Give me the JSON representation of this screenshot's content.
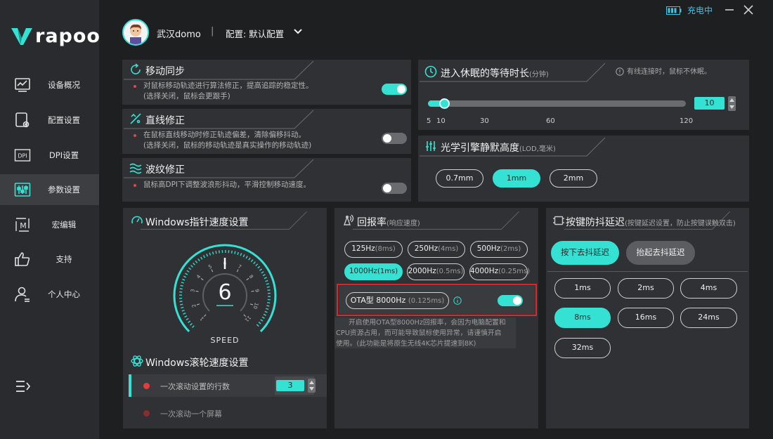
{
  "brand": {
    "name": "rapoo"
  },
  "header": {
    "user_name": "武汉domo",
    "separator": "|",
    "config_label": "配置: 默认配置",
    "charge_status": "充电中"
  },
  "sidebar": {
    "items": [
      {
        "label": "设备概况",
        "icon": "monitor-chart-icon"
      },
      {
        "label": "配置设置",
        "icon": "mouse-settings-icon"
      },
      {
        "label": "DPI设置",
        "icon": "dpi-icon",
        "icon_text": "DPI"
      },
      {
        "label": "参数设置",
        "icon": "sliders-icon",
        "active": true
      },
      {
        "label": "宏编辑",
        "icon": "macro-icon",
        "icon_text": "M"
      },
      {
        "label": "支持",
        "icon": "thumbs-up-icon"
      },
      {
        "label": "个人中心",
        "icon": "user-icon"
      }
    ]
  },
  "motion_sync": {
    "title": "移动同步",
    "desc": [
      "对鼠标移动轨迹进行算法修正，提高追踪的稳定性。",
      "(选择关闭，鼠标会更跟手)"
    ],
    "enabled": true
  },
  "angle_snap": {
    "title": "直线修正",
    "desc": [
      "在鼠标直线移动时修正轨迹偏差，清除偏移抖动。",
      "(选择关闭，鼠标的移动轨迹是真实操作的移动轨迹)"
    ],
    "enabled": false
  },
  "ripple": {
    "title": "波纹修正",
    "desc": [
      "鼠标高DPI下调整波浪形抖动，平滑控制移动速度。"
    ],
    "enabled": false
  },
  "sleep": {
    "title": "进入休眠的等待时长",
    "unit": "(分钟)",
    "note": "有线连接时，鼠标不休眠。",
    "value": "10",
    "min": 5,
    "max": 120,
    "ticks": [
      "5",
      "10",
      "30",
      "60",
      "120"
    ]
  },
  "lod": {
    "title": "光学引擎静默高度",
    "unit": "(LOD,毫米)",
    "options": [
      "0.7mm",
      "1mm",
      "2mm"
    ],
    "selected": "1mm"
  },
  "pointer_speed": {
    "title": "Windows指针速度设置",
    "value": "6",
    "gauge_label": "SPEED",
    "scale": [
      "1",
      "2",
      "3",
      "4",
      "5",
      "6",
      "7",
      "8",
      "9",
      "10",
      "11"
    ]
  },
  "wheel_speed": {
    "title": "Windows滚轮速度设置",
    "line_label": "一次滚动设置的行数",
    "line_value": "3",
    "screen_label": "一次滚动一个屏幕"
  },
  "polling": {
    "title": "回报率",
    "unit": "(响应速度)",
    "options": [
      {
        "rate": "125Hz",
        "ms": "(8ms)"
      },
      {
        "rate": "250Hz",
        "ms": "(4ms)"
      },
      {
        "rate": "500Hz",
        "ms": "(2ms)"
      },
      {
        "rate": "1000Hz",
        "ms": "(1ms)",
        "selected": true
      },
      {
        "rate": "2000Hz",
        "ms": "(0.5ms)"
      },
      {
        "rate": "4000Hz",
        "ms": "(0.25ms)"
      }
    ],
    "ota_label": "OTA型 8000Hz",
    "ota_ms": "(0.125ms)",
    "ota_enabled": true,
    "ota_note": [
      "开启使用OTA型8000Hz回报率，会因为电脑配置和",
      "CPU资源占用，而可能导致鼠标使用异常，请谨慎开启",
      "使用。(此功能是将原生无线4K芯片提速到8K)"
    ]
  },
  "debounce": {
    "title": "按键防抖延迟",
    "unit": "(按键延迟设置，防止按键误触双击)",
    "tabs": [
      "按下去抖延迟",
      "抬起去抖延迟"
    ],
    "active_tab": 0,
    "options": [
      "1ms",
      "2ms",
      "4ms",
      "8ms",
      "16ms",
      "24ms",
      "32ms"
    ],
    "selected": "8ms"
  },
  "colors": {
    "accent": "#35e1d2",
    "panel": "#303134",
    "background": "#1e1f21",
    "sidebar": "#2a2b2e",
    "alert": "#d8282a"
  }
}
